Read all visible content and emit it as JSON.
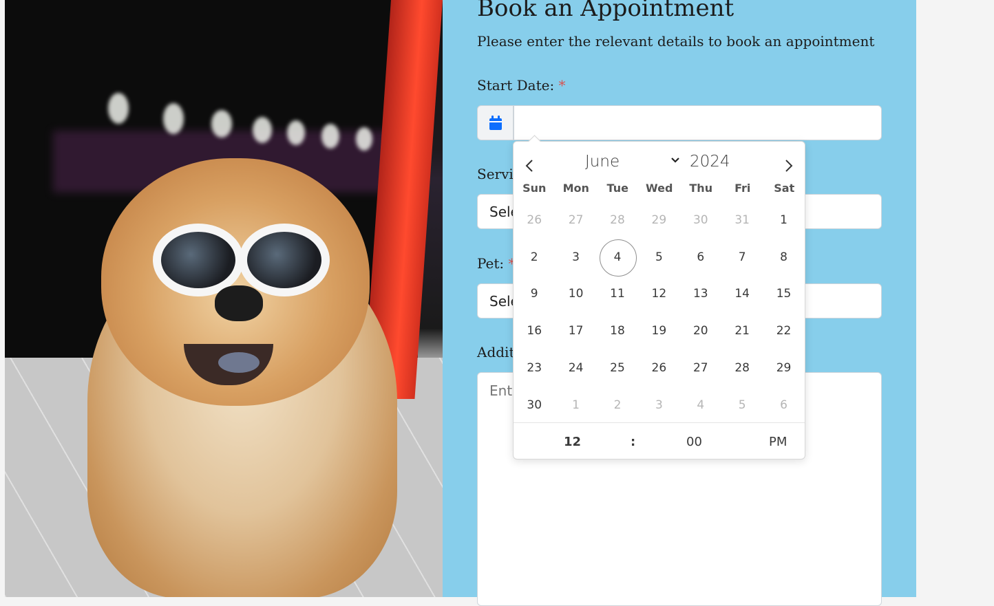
{
  "form": {
    "title": "Book an Appointment",
    "subtitle": "Please enter the relevant details to book an appointment",
    "start_date": {
      "label": "Start Date:",
      "required_mark": "*",
      "icon": "calendar-icon",
      "value": ""
    },
    "service": {
      "label": "Servi",
      "value": "Sele"
    },
    "pet": {
      "label": "Pet:",
      "required_mark": "*",
      "value": "Sele"
    },
    "additional": {
      "label": "Addit",
      "placeholder": "Ente"
    }
  },
  "datepicker": {
    "month": "June",
    "year": "2024",
    "weekdays": [
      "Sun",
      "Mon",
      "Tue",
      "Wed",
      "Thu",
      "Fri",
      "Sat"
    ],
    "days": [
      {
        "d": "26",
        "muted": true
      },
      {
        "d": "27",
        "muted": true
      },
      {
        "d": "28",
        "muted": true
      },
      {
        "d": "29",
        "muted": true
      },
      {
        "d": "30",
        "muted": true
      },
      {
        "d": "31",
        "muted": true
      },
      {
        "d": "1"
      },
      {
        "d": "2"
      },
      {
        "d": "3"
      },
      {
        "d": "4",
        "today": true
      },
      {
        "d": "5"
      },
      {
        "d": "6"
      },
      {
        "d": "7"
      },
      {
        "d": "8"
      },
      {
        "d": "9"
      },
      {
        "d": "10"
      },
      {
        "d": "11"
      },
      {
        "d": "12"
      },
      {
        "d": "13"
      },
      {
        "d": "14"
      },
      {
        "d": "15"
      },
      {
        "d": "16"
      },
      {
        "d": "17"
      },
      {
        "d": "18"
      },
      {
        "d": "19"
      },
      {
        "d": "20"
      },
      {
        "d": "21"
      },
      {
        "d": "22"
      },
      {
        "d": "23"
      },
      {
        "d": "24"
      },
      {
        "d": "25"
      },
      {
        "d": "26"
      },
      {
        "d": "27"
      },
      {
        "d": "28"
      },
      {
        "d": "29"
      },
      {
        "d": "30"
      },
      {
        "d": "1",
        "muted": true
      },
      {
        "d": "2",
        "muted": true
      },
      {
        "d": "3",
        "muted": true
      },
      {
        "d": "4",
        "muted": true
      },
      {
        "d": "5",
        "muted": true
      },
      {
        "d": "6",
        "muted": true
      }
    ],
    "time": {
      "hour": "12",
      "separator": ":",
      "minute": "00",
      "ampm": "PM"
    }
  },
  "colors": {
    "panel": "#87ceeb",
    "accent": "#0d6efd",
    "required": "#d9534f"
  }
}
